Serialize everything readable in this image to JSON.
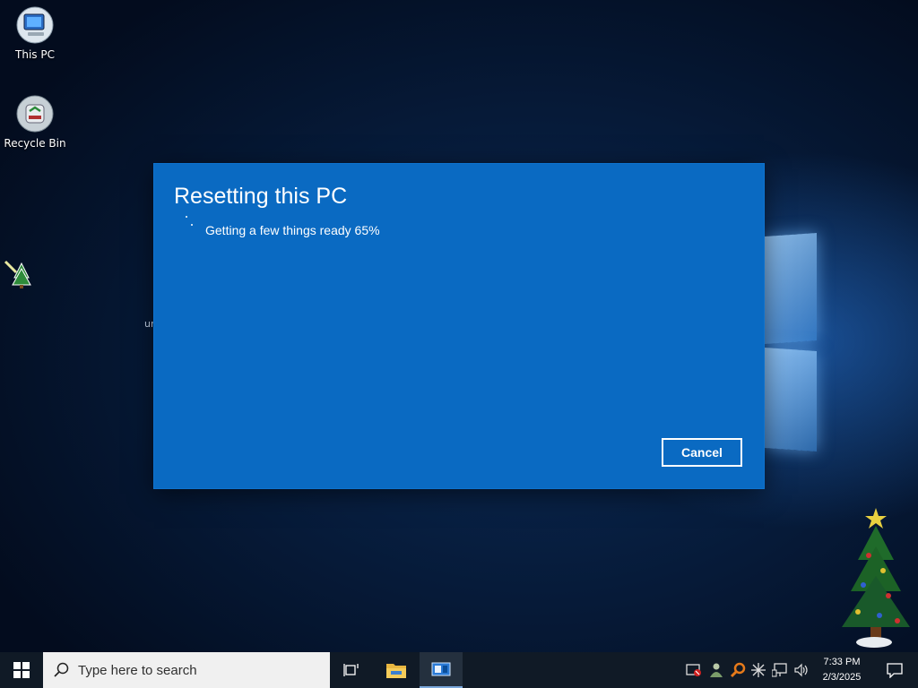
{
  "desktop": {
    "icons": [
      {
        "label": "This PC",
        "icon": "computer-icon"
      },
      {
        "label": "Recycle Bin",
        "icon": "recycle-bin-icon"
      }
    ],
    "stray_text": "ur"
  },
  "dialog": {
    "title": "Resetting this PC",
    "progress_text": "Getting a few things ready 65%",
    "progress_percent": 65,
    "cancel_label": "Cancel",
    "accent_color": "#0a6ac2"
  },
  "taskbar": {
    "search_placeholder": "Type here to search",
    "pinned": [
      {
        "icon": "task-view-icon"
      },
      {
        "icon": "file-explorer-icon"
      },
      {
        "icon": "reset-app-icon",
        "active": true
      }
    ],
    "tray": [
      "security-alert-icon",
      "people-icon",
      "search-tool-icon",
      "sparkle-icon",
      "network-icon",
      "volume-icon"
    ],
    "clock": {
      "time": "7:33 PM",
      "date": "2/3/2025"
    },
    "notifications_icon": "action-center-icon"
  }
}
